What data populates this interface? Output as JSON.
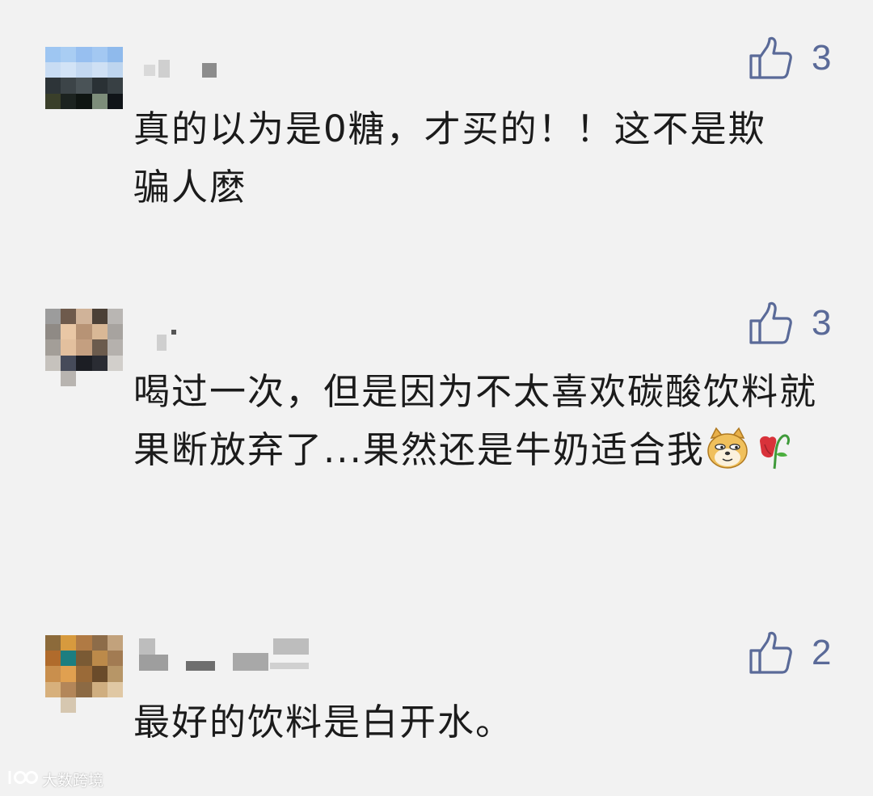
{
  "comments": [
    {
      "likes": "3",
      "text": "真的以为是0糖，才买的！！这不是欺骗人麽"
    },
    {
      "likes": "3",
      "text": "喝过一次，但是因为不太喜欢碳酸饮料就果断放弃了...果然还是牛奶适合我"
    },
    {
      "likes": "2",
      "text": "最好的饮料是白开水。"
    }
  ],
  "icons": {
    "like": "thumbs-up-icon",
    "emoji_1": "doge-emoji",
    "emoji_2": "wilted-flower-emoji"
  },
  "colors": {
    "background": "#f2f2f2",
    "like_accent": "#5a6a98",
    "comment_text": "#1b1b1b"
  },
  "watermark": {
    "text": "大数跨境"
  }
}
